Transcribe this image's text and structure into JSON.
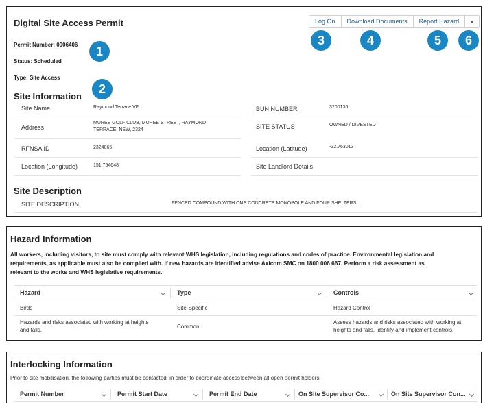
{
  "permit": {
    "title": "Digital Site Access Permit",
    "permit_number": "Permit Number: 0006406",
    "status": "Status: Scheduled",
    "type": "Type: Site Access",
    "buttons": {
      "log_on": "Log On",
      "download": "Download Documents",
      "report_hazard": "Report Hazard"
    }
  },
  "badges": [
    "1",
    "2",
    "3",
    "4",
    "5",
    "6"
  ],
  "site_info": {
    "title": "Site Information",
    "site_name_label": "Site Name",
    "site_name_value": "Raymond Terrace VF",
    "address_label": "Address",
    "address_line1": "MUREE GOLF CLUB, MUREE STREET, RAYMOND",
    "address_line2": "TERRACE, NSW, 2324",
    "rfnsa_label": "RFNSA ID",
    "rfnsa_value": "2324065",
    "longitude_label": "Location (Longitude)",
    "longitude_value": "151.754648",
    "bun_label": "BUN NUMBER",
    "bun_value": "3200136",
    "status_label": "SITE STATUS",
    "status_value": "OWNED / DIVESTED",
    "latitude_label": "Location (Latitude)",
    "latitude_value": "-32.763013",
    "landlord_label": "Site Landlord Details"
  },
  "site_description": {
    "title": "Site Description",
    "label": "SITE DESCRIPTION",
    "value": "FENCED COMPOUND WITH ONE CONCRETE MONOPOLE AND FOUR SHELTERS."
  },
  "hazard": {
    "title": "Hazard Information",
    "para_line1": "All workers, including visitors, to site must comply with relevant WHS legislation, including regulations and codes of practice. Environmental legislation and",
    "para_line2": "requirements, as applicable must also be complied with. If new hazards are identified advise Axicom SMC on 1800 006 667. Perform a risk assessment as",
    "para_line3": "relevant to the works and WHS legislative requirements.",
    "columns": [
      "Hazard",
      "Type",
      "Controls"
    ],
    "rows": [
      {
        "hazard1": "Birds",
        "hazard2": "",
        "type": "Site-Specific",
        "controls1": "Hazard Control",
        "controls2": ""
      },
      {
        "hazard1": "Hazards and risks associated with working at heights",
        "hazard2": "and falls.",
        "type": "Common",
        "controls1": "Assess hazards and risks associated with working at",
        "controls2": "heights and falls. Identify and implement controls."
      }
    ]
  },
  "interlocking": {
    "title": "Interlocking Information",
    "intro": "Prior to site mobilisation, the following parties must be contacted, in order to coordinate access between all open permit holders",
    "columns": [
      "Permit Number",
      "Permit Start Date",
      "Permit End Date",
      "On Site Supervisor Co...",
      "On Site Supervisor Con..."
    ]
  }
}
